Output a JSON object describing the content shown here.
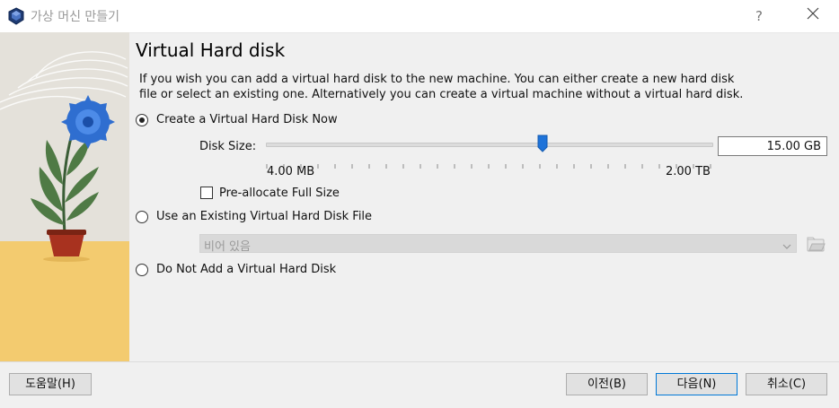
{
  "window": {
    "title": "가상 머신 만들기",
    "help_label": "?",
    "app_icon": "virtualbox-icon",
    "close_icon": "close-icon"
  },
  "page": {
    "heading": "Virtual Hard disk",
    "description_line1": "If you wish you can add a virtual hard disk to the new machine. You can either create a new hard disk",
    "description_line2": "file or select an existing one. Alternatively you can create a virtual machine without a virtual hard disk."
  },
  "options": {
    "create_now": {
      "label": "Create a Virtual Hard Disk Now",
      "checked": true
    },
    "use_existing": {
      "label": "Use an Existing Virtual Hard Disk File",
      "checked": false
    },
    "no_disk": {
      "label": "Do Not Add a Virtual Hard Disk",
      "checked": false
    }
  },
  "disk_size": {
    "label": "Disk Size:",
    "value": "15.00 GB",
    "min_label": "4.00 MB",
    "max_label": "2.00 TB",
    "slider_fraction": 0.62
  },
  "preallocate": {
    "label": "Pre-allocate Full Size",
    "checked": false
  },
  "existing_file": {
    "selected": "비어 있음",
    "folder_icon": "folder-icon"
  },
  "buttons": {
    "help": "도움말(H)",
    "back": "이전(B)",
    "next": "다음(N)",
    "cancel": "취소(C)"
  },
  "colors": {
    "accent": "#1e73d9",
    "illustration_yellow": "#f3cb6f"
  }
}
